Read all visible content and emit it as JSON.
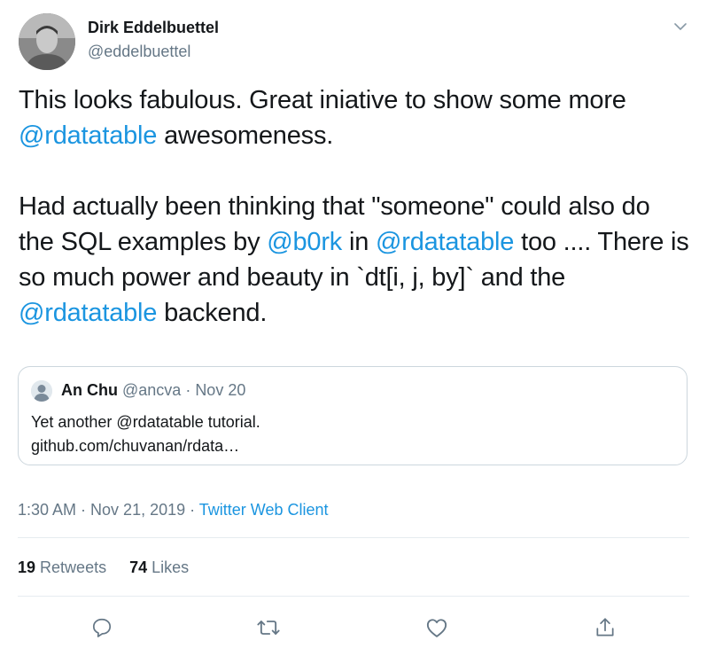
{
  "author": {
    "name": "Dirk Eddelbuettel",
    "handle": "@eddelbuettel"
  },
  "tweet": {
    "p1": {
      "t1": "This looks fabulous. Great iniative to show some more ",
      "m1": "@rdatatable",
      "t2": " awesomeness."
    },
    "p2": {
      "t1": "Had actually been thinking that \"someone\" could also do the SQL examples by ",
      "m1": "@b0rk",
      "t2": " in ",
      "m2": "@rdatatable",
      "t3": " too .... There is so much power and beauty in `dt[i, j, by]` and the ",
      "m3": "@rdatatable",
      "t4": " backend."
    }
  },
  "quote": {
    "name": "An Chu",
    "handle": "@ancva",
    "separator": " · ",
    "date": "Nov 20",
    "line1": "Yet another @rdatatable tutorial.",
    "line2": "github.com/chuvanan/rdata…"
  },
  "meta": {
    "time": "1:30 AM",
    "separator": " · ",
    "date": "Nov 21, 2019",
    "client": "Twitter Web Client"
  },
  "stats": {
    "retweets_count": "19",
    "retweets_label": "Retweets",
    "likes_count": "74",
    "likes_label": "Likes"
  },
  "icons": {
    "menu": "chevron-down-icon",
    "reply": "reply-icon",
    "retweet": "retweet-icon",
    "like": "heart-icon",
    "share": "share-icon"
  },
  "colors": {
    "link": "#1b95e0",
    "secondary": "#657786",
    "text": "#14171a",
    "border": "#ccd6dd"
  }
}
